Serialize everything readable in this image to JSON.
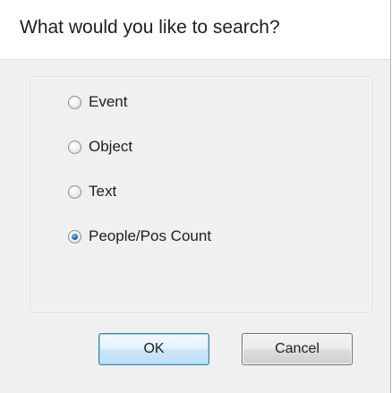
{
  "dialog": {
    "title": "What would you like to search?"
  },
  "options": [
    {
      "label": "Event",
      "checked": false
    },
    {
      "label": "Object",
      "checked": false
    },
    {
      "label": "Text",
      "checked": false
    },
    {
      "label": "People/Pos Count",
      "checked": true
    }
  ],
  "buttons": {
    "ok_label": "OK",
    "cancel_label": "Cancel"
  },
  "colors": {
    "accent": "#1d6fb1",
    "default_button_border": "#3c7fb1"
  }
}
